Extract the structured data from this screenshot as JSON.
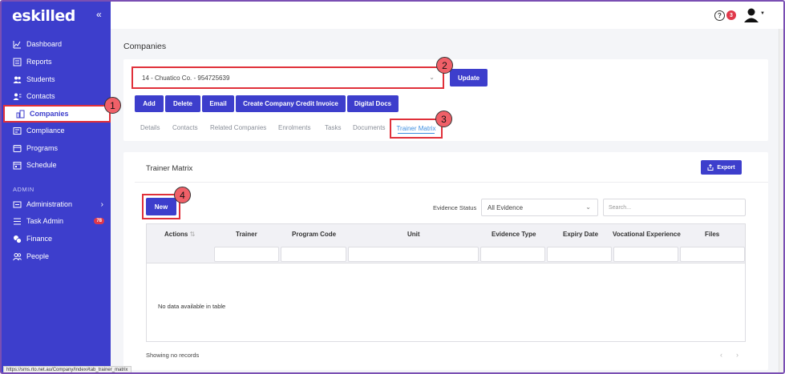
{
  "sidebar": {
    "logo": "eskilled",
    "collapse_icon": "double-chevron-left-icon",
    "items": [
      {
        "label": "Dashboard",
        "icon": "chart-line-icon"
      },
      {
        "label": "Reports",
        "icon": "report-icon"
      },
      {
        "label": "Students",
        "icon": "users-icon"
      },
      {
        "label": "Contacts",
        "icon": "contact-icon"
      },
      {
        "label": "Companies",
        "icon": "building-icon"
      },
      {
        "label": "Compliance",
        "icon": "compliance-icon"
      },
      {
        "label": "Programs",
        "icon": "programs-icon"
      },
      {
        "label": "Schedule",
        "icon": "calendar-icon"
      }
    ],
    "admin_section": "ADMIN",
    "admin_items": [
      {
        "label": "Administration",
        "icon": "gear-icon"
      },
      {
        "label": "Task Admin",
        "icon": "list-icon",
        "badge": "78"
      },
      {
        "label": "Finance",
        "icon": "coins-icon"
      },
      {
        "label": "People",
        "icon": "people-icon"
      }
    ]
  },
  "topbar": {
    "help_badge": "3"
  },
  "page": {
    "title": "Companies",
    "company_select": "14 - Chuatico Co. - 954725639",
    "update_label": "Update",
    "actions": [
      "Add",
      "Delete",
      "Email",
      "Create Company Credit Invoice",
      "Digital Docs"
    ],
    "tabs": [
      "Details",
      "Contacts",
      "Related Companies",
      "Enrolments",
      "Tasks",
      "Documents",
      "Trainer Matrix"
    ]
  },
  "matrix": {
    "title": "Trainer Matrix",
    "export_label": "Export",
    "new_label": "New",
    "evidence_status_label": "Evidence Status",
    "evidence_status_value": "All Evidence",
    "search_placeholder": "Search...",
    "columns": [
      "Actions",
      "Trainer",
      "Program Code",
      "Unit",
      "Evidence Type",
      "Expiry Date",
      "Vocational Experience",
      "Files"
    ],
    "empty_text": "No data available in table",
    "footer": "Showing no records"
  },
  "callouts": [
    "1",
    "2",
    "3",
    "4"
  ],
  "statusbar": "https://sms.rto.net.au/Company/Index#tab_trainer_matrix",
  "colors": {
    "primary": "#3d3ecc",
    "highlight": "#e0303a",
    "callout": "#f06068",
    "badge": "#e0384a",
    "tab_active": "#3d8ee0"
  }
}
